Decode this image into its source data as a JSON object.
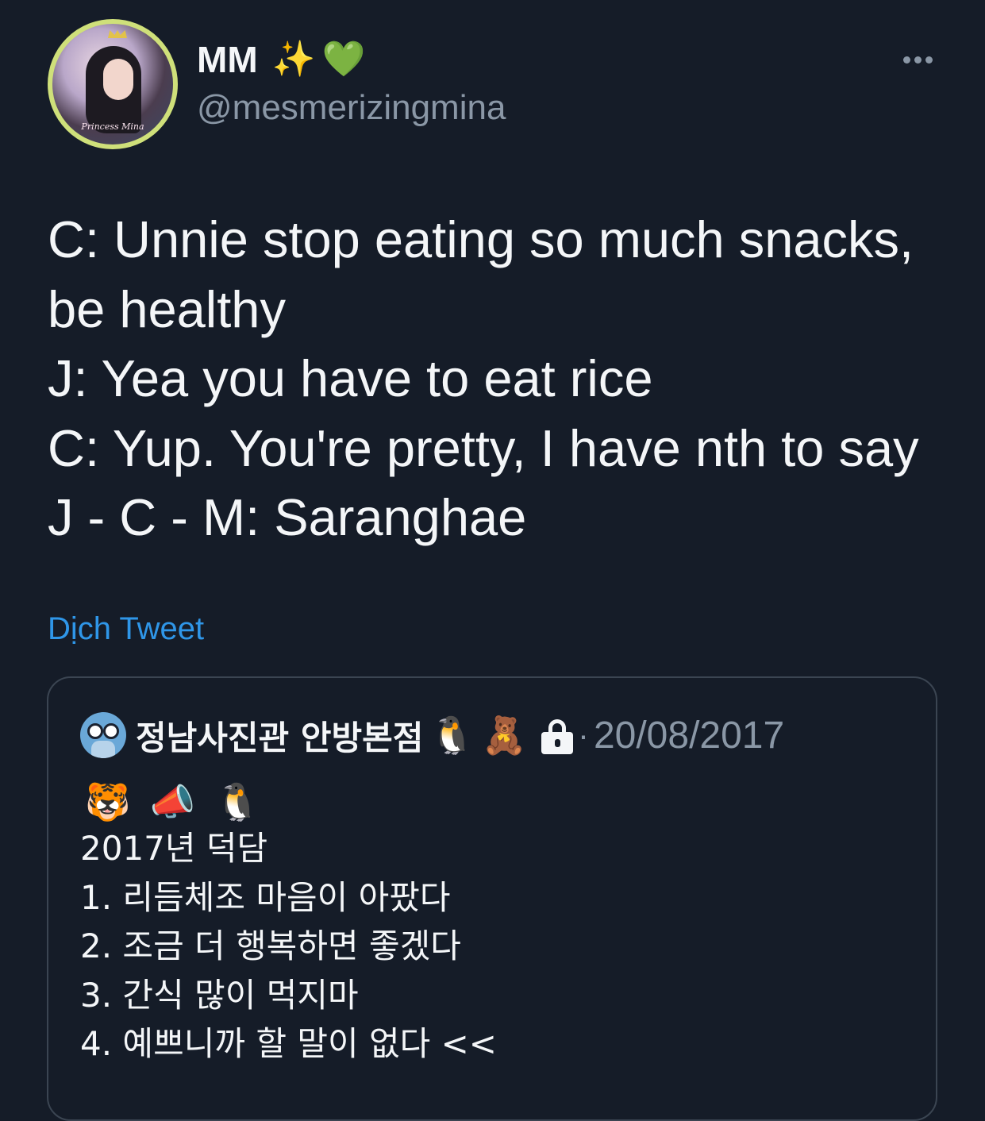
{
  "author": {
    "display_name": "MM",
    "name_emojis": [
      "✨",
      "💚"
    ],
    "handle": "@mesmerizingmina",
    "avatar_text": "Princess Mina"
  },
  "more_icon": "more-horizontal-icon",
  "tweet": {
    "lines": [
      "C: Unnie stop eating so much snacks,",
      "be healthy",
      "J: Yea you have to eat rice",
      "C: Yup. You're pretty, I have nth to say",
      "J - C - M: Saranghae"
    ],
    "translate_label": "Dịch Tweet"
  },
  "quote": {
    "author_name": "정남사진관 안방본점",
    "name_emojis": [
      "🐧",
      "🧸"
    ],
    "protected_icon": "lock-icon",
    "separator": "·",
    "date": "20/08/2017",
    "emojis": [
      "🐯",
      "📣",
      "🐧"
    ],
    "lines": [
      "2017년 덕담",
      "1. 리듬체조 마음이 아팠다",
      "2. 조금 더 행복하면 좋겠다",
      "3. 간식 많이 먹지마",
      "4. 예쁘니까 할 말이 없다 <<"
    ]
  },
  "colors": {
    "background": "#151c28",
    "text": "#f4f6f8",
    "secondary": "#8a97a6",
    "link": "#2f96e8",
    "border": "#3b4552"
  }
}
